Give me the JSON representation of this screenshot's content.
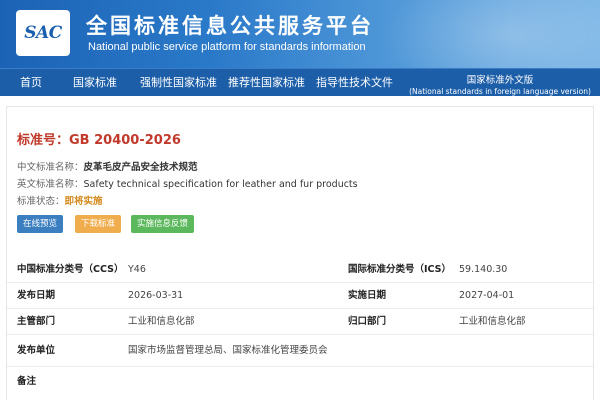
{
  "header": {
    "logo_text": "SAC",
    "title_cn": "全国标准信息公共服务平台",
    "title_en": "National public service platform  for standards information"
  },
  "nav": {
    "items": [
      "首页",
      "国家标准",
      "强制性国家标准",
      "推荐性国家标准",
      "指导性技术文件"
    ],
    "foreign": {
      "line1": "国家标准外文版",
      "line2": "(National standards in foreign language version)"
    }
  },
  "standard": {
    "number": "标准号：GB 20400-2026",
    "cn_name_label": "中文标准名称：",
    "cn_name": "皮革毛皮产品安全技术规范",
    "en_name_label": "英文标准名称：",
    "en_name": "Safety technical specification for leather and fur products",
    "status_label": "标准状态：",
    "status": "即将实施"
  },
  "buttons": {
    "preview": "在线预览",
    "download": "下载标准",
    "feedback": "实施信息反馈"
  },
  "details": {
    "ccs_label": "中国标准分类号（CCS）",
    "ccs": "Y46",
    "ics_label": "国际标准分类号（ICS）",
    "ics": "59.140.30",
    "publish_label": "发布日期",
    "publish": "2026-03-31",
    "implement_label": "实施日期",
    "implement": "2027-04-01",
    "authority_label": "主管部门",
    "authority": "工业和信息化部",
    "owner_label": "归口部门",
    "owner": "工业和信息化部",
    "publisher_label": "发布单位",
    "publisher": "国家市场监督管理总局、国家标准化管理委员会",
    "remark_label": "备注"
  },
  "colors": {
    "header_blue": "#1c63b5",
    "nav_blue": "#1c5ea8",
    "std_number_red": "#c0392b",
    "status_orange": "#d38b1f",
    "btn_blue": "#3c7fc1",
    "btn_orange": "#f0ad4e",
    "btn_green": "#5cb85c"
  }
}
